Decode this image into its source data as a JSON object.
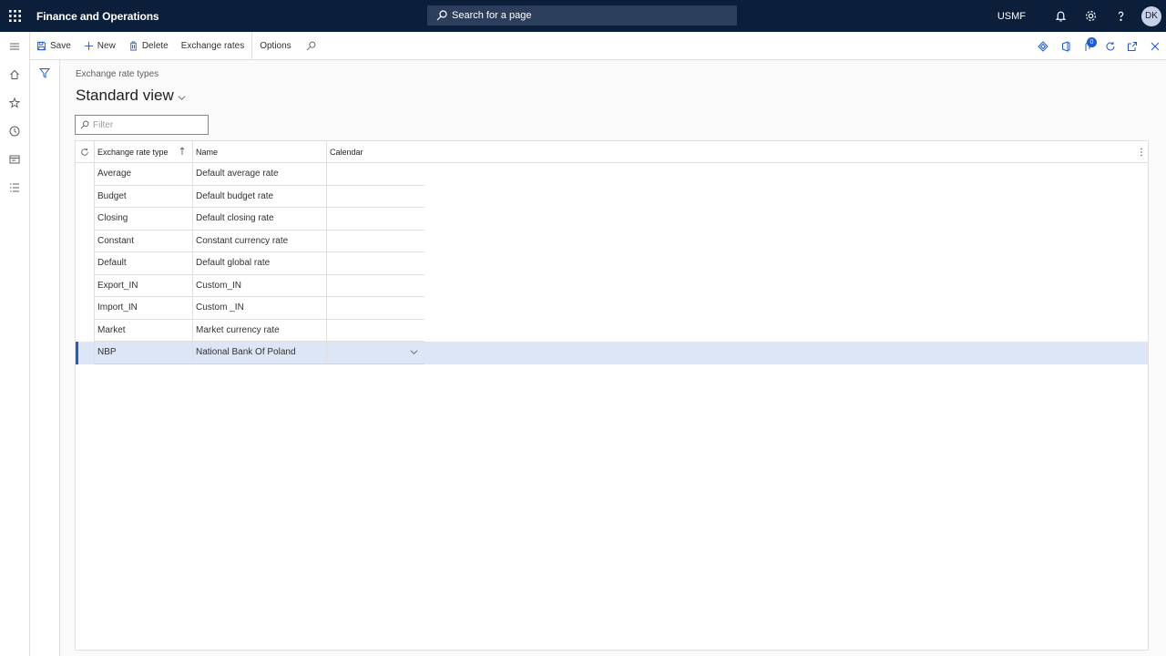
{
  "topbar": {
    "app_title": "Finance and Operations",
    "search_label": "Search for a page",
    "company": "USMF",
    "avatar_initials": "DK",
    "icons": [
      "app-launcher-icon",
      "search-icon",
      "bell-icon",
      "gear-icon",
      "help-icon"
    ]
  },
  "actions": {
    "save": "Save",
    "new": "New",
    "delete": "Delete",
    "exchange_rates": "Exchange rates",
    "options": "Options",
    "badge_count": "0"
  },
  "page": {
    "breadcrumb": "Exchange rate types",
    "title": "Standard view",
    "filter_placeholder": "Filter"
  },
  "grid": {
    "columns": [
      "Exchange rate type",
      "Name",
      "Calendar"
    ],
    "rows": [
      {
        "type": "Average",
        "name": "Default average rate",
        "calendar": ""
      },
      {
        "type": "Budget",
        "name": "Default budget rate",
        "calendar": ""
      },
      {
        "type": "Closing",
        "name": "Default closing rate",
        "calendar": ""
      },
      {
        "type": "Constant",
        "name": "Constant currency rate",
        "calendar": ""
      },
      {
        "type": "Default",
        "name": "Default global rate",
        "calendar": ""
      },
      {
        "type": "Export_IN",
        "name": "Custom_IN",
        "calendar": ""
      },
      {
        "type": "Import_IN",
        "name": "Custom _IN",
        "calendar": ""
      },
      {
        "type": "Market",
        "name": "Market currency rate",
        "calendar": ""
      },
      {
        "type": "NBP",
        "name": "National Bank Of Poland",
        "calendar": ""
      }
    ],
    "selected_row": 8
  },
  "colors": {
    "topbar": "#0c1f3a",
    "accent": "#1d5bd3",
    "selected_row": "#dce6f7"
  }
}
